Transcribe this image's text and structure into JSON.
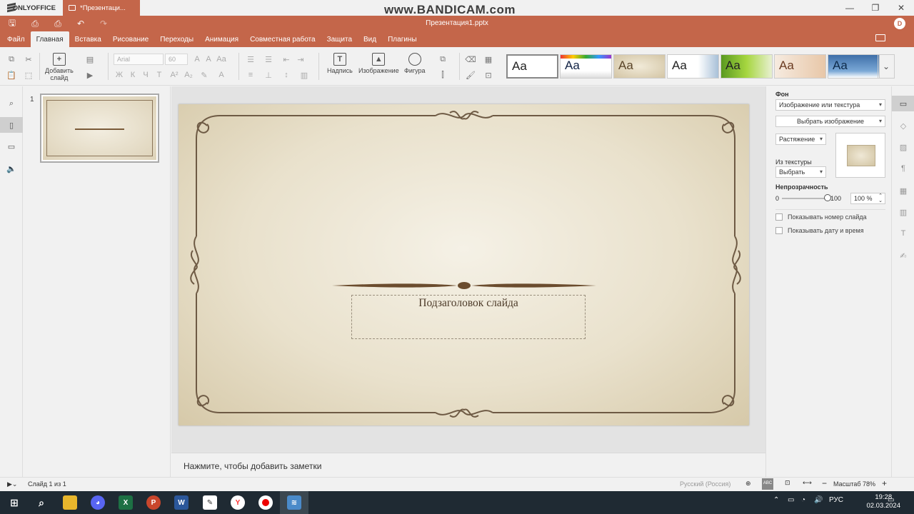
{
  "titlebar": {
    "brand": "ONLYOFFICE",
    "tab_label": "*Презентаци...",
    "watermark": "www.BANDICAM.com"
  },
  "header": {
    "doc_title": "Презентация1.pptx",
    "avatar_initial": "D"
  },
  "menu": {
    "tabs": [
      "Файл",
      "Главная",
      "Вставка",
      "Рисование",
      "Переходы",
      "Анимация",
      "Совместная работа",
      "Защита",
      "Вид",
      "Плагины"
    ],
    "active": "Главная"
  },
  "toolbar": {
    "add_slide_label_1": "Добавить",
    "add_slide_label_2": "слайд",
    "font_name_placeholder": "Arial",
    "font_size_placeholder": "60",
    "textbox_label": "Надпись",
    "image_label": "Изображение",
    "shape_label": "Фигура",
    "theme_sample": "Aa"
  },
  "thumbnails": {
    "slide_number": "1"
  },
  "slide": {
    "subtitle": "Подзаголовок слайда"
  },
  "notes": {
    "placeholder": "Нажмите, чтобы добавить заметки"
  },
  "right_panel": {
    "background_label": "Фон",
    "fill_type": "Изображение или текстура",
    "select_image_button": "Выбрать изображение",
    "stretch_select": "Растяжение",
    "from_texture_label": "Из текстуры",
    "texture_select": "Выбрать",
    "opacity_label": "Непрозрачность",
    "opacity_min": "0",
    "opacity_max": "100",
    "opacity_value": "100 %",
    "opacity_level": 1.0,
    "show_slide_number": "Показывать номер слайда",
    "show_date_time": "Показывать дату и время"
  },
  "statusbar": {
    "slide_count": "Слайд 1 из 1",
    "language": "Русский (Россия)",
    "zoom": "Масштаб 78%"
  },
  "taskbar": {
    "lang": "РУС",
    "time": "19:28",
    "date": "02.03.2024"
  }
}
